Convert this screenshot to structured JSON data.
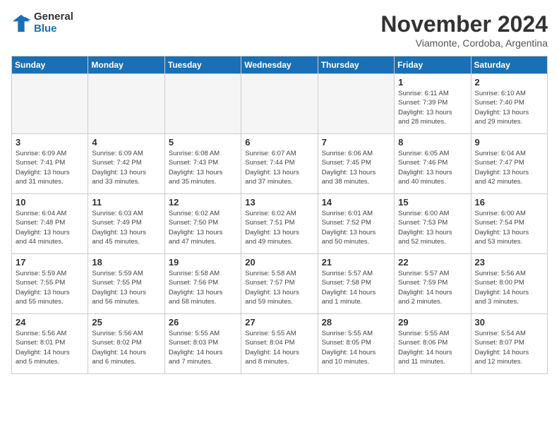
{
  "header": {
    "logo_line1": "General",
    "logo_line2": "Blue",
    "month_title": "November 2024",
    "location": "Viamonte, Cordoba, Argentina"
  },
  "days_of_week": [
    "Sunday",
    "Monday",
    "Tuesday",
    "Wednesday",
    "Thursday",
    "Friday",
    "Saturday"
  ],
  "weeks": [
    [
      {
        "day": "",
        "info": ""
      },
      {
        "day": "",
        "info": ""
      },
      {
        "day": "",
        "info": ""
      },
      {
        "day": "",
        "info": ""
      },
      {
        "day": "",
        "info": ""
      },
      {
        "day": "1",
        "info": "Sunrise: 6:11 AM\nSunset: 7:39 PM\nDaylight: 13 hours\nand 28 minutes."
      },
      {
        "day": "2",
        "info": "Sunrise: 6:10 AM\nSunset: 7:40 PM\nDaylight: 13 hours\nand 29 minutes."
      }
    ],
    [
      {
        "day": "3",
        "info": "Sunrise: 6:09 AM\nSunset: 7:41 PM\nDaylight: 13 hours\nand 31 minutes."
      },
      {
        "day": "4",
        "info": "Sunrise: 6:09 AM\nSunset: 7:42 PM\nDaylight: 13 hours\nand 33 minutes."
      },
      {
        "day": "5",
        "info": "Sunrise: 6:08 AM\nSunset: 7:43 PM\nDaylight: 13 hours\nand 35 minutes."
      },
      {
        "day": "6",
        "info": "Sunrise: 6:07 AM\nSunset: 7:44 PM\nDaylight: 13 hours\nand 37 minutes."
      },
      {
        "day": "7",
        "info": "Sunrise: 6:06 AM\nSunset: 7:45 PM\nDaylight: 13 hours\nand 38 minutes."
      },
      {
        "day": "8",
        "info": "Sunrise: 6:05 AM\nSunset: 7:46 PM\nDaylight: 13 hours\nand 40 minutes."
      },
      {
        "day": "9",
        "info": "Sunrise: 6:04 AM\nSunset: 7:47 PM\nDaylight: 13 hours\nand 42 minutes."
      }
    ],
    [
      {
        "day": "10",
        "info": "Sunrise: 6:04 AM\nSunset: 7:48 PM\nDaylight: 13 hours\nand 44 minutes."
      },
      {
        "day": "11",
        "info": "Sunrise: 6:03 AM\nSunset: 7:49 PM\nDaylight: 13 hours\nand 45 minutes."
      },
      {
        "day": "12",
        "info": "Sunrise: 6:02 AM\nSunset: 7:50 PM\nDaylight: 13 hours\nand 47 minutes."
      },
      {
        "day": "13",
        "info": "Sunrise: 6:02 AM\nSunset: 7:51 PM\nDaylight: 13 hours\nand 49 minutes."
      },
      {
        "day": "14",
        "info": "Sunrise: 6:01 AM\nSunset: 7:52 PM\nDaylight: 13 hours\nand 50 minutes."
      },
      {
        "day": "15",
        "info": "Sunrise: 6:00 AM\nSunset: 7:53 PM\nDaylight: 13 hours\nand 52 minutes."
      },
      {
        "day": "16",
        "info": "Sunrise: 6:00 AM\nSunset: 7:54 PM\nDaylight: 13 hours\nand 53 minutes."
      }
    ],
    [
      {
        "day": "17",
        "info": "Sunrise: 5:59 AM\nSunset: 7:55 PM\nDaylight: 13 hours\nand 55 minutes."
      },
      {
        "day": "18",
        "info": "Sunrise: 5:59 AM\nSunset: 7:55 PM\nDaylight: 13 hours\nand 56 minutes."
      },
      {
        "day": "19",
        "info": "Sunrise: 5:58 AM\nSunset: 7:56 PM\nDaylight: 13 hours\nand 58 minutes."
      },
      {
        "day": "20",
        "info": "Sunrise: 5:58 AM\nSunset: 7:57 PM\nDaylight: 13 hours\nand 59 minutes."
      },
      {
        "day": "21",
        "info": "Sunrise: 5:57 AM\nSunset: 7:58 PM\nDaylight: 14 hours\nand 1 minute."
      },
      {
        "day": "22",
        "info": "Sunrise: 5:57 AM\nSunset: 7:59 PM\nDaylight: 14 hours\nand 2 minutes."
      },
      {
        "day": "23",
        "info": "Sunrise: 5:56 AM\nSunset: 8:00 PM\nDaylight: 14 hours\nand 3 minutes."
      }
    ],
    [
      {
        "day": "24",
        "info": "Sunrise: 5:56 AM\nSunset: 8:01 PM\nDaylight: 14 hours\nand 5 minutes."
      },
      {
        "day": "25",
        "info": "Sunrise: 5:56 AM\nSunset: 8:02 PM\nDaylight: 14 hours\nand 6 minutes."
      },
      {
        "day": "26",
        "info": "Sunrise: 5:55 AM\nSunset: 8:03 PM\nDaylight: 14 hours\nand 7 minutes."
      },
      {
        "day": "27",
        "info": "Sunrise: 5:55 AM\nSunset: 8:04 PM\nDaylight: 14 hours\nand 8 minutes."
      },
      {
        "day": "28",
        "info": "Sunrise: 5:55 AM\nSunset: 8:05 PM\nDaylight: 14 hours\nand 10 minutes."
      },
      {
        "day": "29",
        "info": "Sunrise: 5:55 AM\nSunset: 8:06 PM\nDaylight: 14 hours\nand 11 minutes."
      },
      {
        "day": "30",
        "info": "Sunrise: 5:54 AM\nSunset: 8:07 PM\nDaylight: 14 hours\nand 12 minutes."
      }
    ]
  ]
}
